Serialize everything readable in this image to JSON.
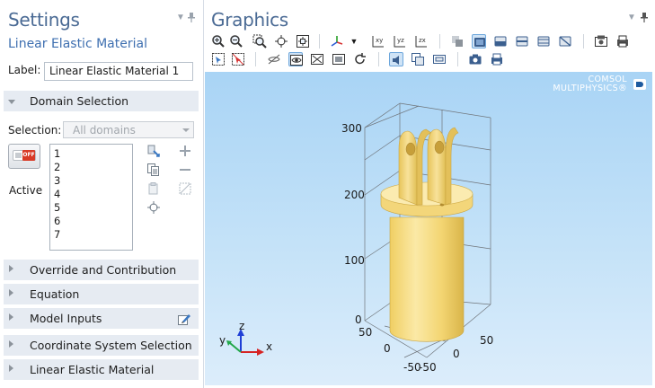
{
  "settings": {
    "title": "Settings",
    "subtitle": "Linear Elastic Material",
    "label_caption": "Label:",
    "label_value": "Linear Elastic Material 1",
    "domain_selection": {
      "header": "Domain Selection",
      "selection_caption": "Selection:",
      "selection_value": "All domains",
      "active_label": "Active",
      "toggle_text": "OFF",
      "domains": [
        "1",
        "2",
        "3",
        "4",
        "5",
        "6",
        "7"
      ]
    },
    "sections": [
      {
        "label": "Override and Contribution"
      },
      {
        "label": "Equation"
      },
      {
        "label": "Model Inputs"
      },
      {
        "label": "Coordinate System Selection"
      },
      {
        "label": "Linear Elastic Material"
      }
    ]
  },
  "graphics": {
    "title": "Graphics",
    "brand_line1": "COMSOL",
    "brand_line2": "MULTIPHYSICS",
    "brand_mark": "®",
    "axis_ticks": {
      "z": [
        "300",
        "200",
        "100",
        "0"
      ],
      "y": [
        "50",
        "0",
        "-50"
      ],
      "x": [
        "50",
        "0",
        "-50"
      ]
    },
    "triad": {
      "x": "x",
      "y": "y",
      "z": "z"
    }
  },
  "colors": {
    "title_blue": "#4a6a94",
    "subtitle_blue": "#3e6fb0",
    "section_bg": "#e6ebf2",
    "viewport_top": "#a9d4f5",
    "viewport_bottom": "#dcedfb",
    "part_yellow": "#f5db7c",
    "off_red": "#d83a26"
  }
}
